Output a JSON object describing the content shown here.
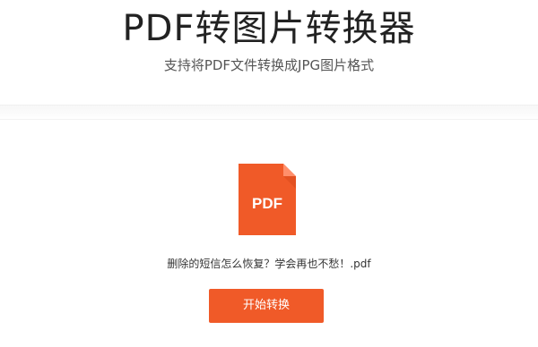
{
  "header": {
    "title": "PDF转图片转换器",
    "subtitle": "支持将PDF文件转换成JPG图片格式"
  },
  "file": {
    "icon_name": "pdf-file-icon",
    "icon_label": "PDF",
    "icon_color": "#f05a28",
    "name": "删除的短信怎么恢复？学会再也不愁！.pdf"
  },
  "actions": {
    "convert_label": "开始转换",
    "convert_color": "#f05a28"
  }
}
